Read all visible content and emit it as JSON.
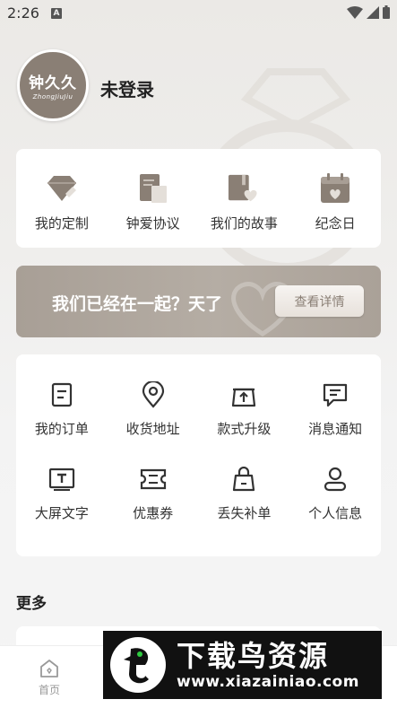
{
  "status_bar": {
    "time": "2:26",
    "notification_letter": "A"
  },
  "profile": {
    "avatar_cn": "钟久久",
    "avatar_en": "ZhongJiuJiu",
    "login_status": "未登录"
  },
  "shortcuts": [
    {
      "label": "我的定制",
      "icon": "diamond-icon"
    },
    {
      "label": "钟爱协议",
      "icon": "document-icon"
    },
    {
      "label": "我们的故事",
      "icon": "book-heart-icon"
    },
    {
      "label": "纪念日",
      "icon": "calendar-heart-icon"
    }
  ],
  "banner": {
    "text": "我们已经在一起？天了",
    "button_label": "查看详情"
  },
  "services": [
    {
      "label": "我的订单",
      "icon": "order-icon"
    },
    {
      "label": "收货地址",
      "icon": "location-pin-icon"
    },
    {
      "label": "款式升级",
      "icon": "upgrade-icon"
    },
    {
      "label": "消息通知",
      "icon": "message-icon"
    },
    {
      "label": "大屏文字",
      "icon": "large-text-icon"
    },
    {
      "label": "优惠券",
      "icon": "coupon-icon"
    },
    {
      "label": "丢失补单",
      "icon": "shopping-bag-icon"
    },
    {
      "label": "个人信息",
      "icon": "user-icon"
    }
  ],
  "more": {
    "title": "更多"
  },
  "bottom_nav": {
    "home_label": "首页"
  },
  "watermark": {
    "brand": "下载鸟资源",
    "url": "www.xiazainiao.com"
  },
  "colors": {
    "accent": "#8a7f75",
    "banner": "#b0a79e"
  }
}
